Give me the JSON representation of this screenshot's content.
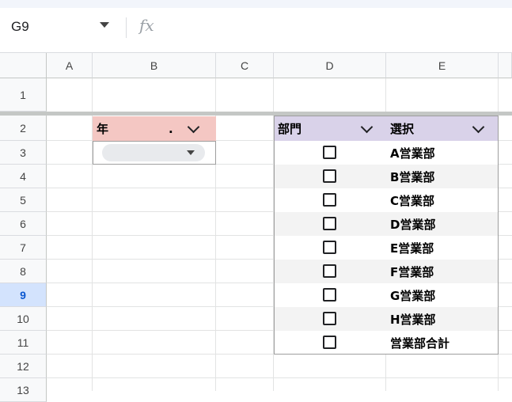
{
  "formula_bar": {
    "name_box": "G9",
    "fx_label": "fx",
    "formula": ""
  },
  "columns": [
    "A",
    "B",
    "C",
    "D",
    "E"
  ],
  "rows": [
    "1",
    "2",
    "3",
    "4",
    "5",
    "6",
    "7",
    "8",
    "9",
    "10",
    "11",
    "12",
    "13"
  ],
  "selected_row": "9",
  "year_header": {
    "label": "年",
    "dot": "."
  },
  "dept_table": {
    "header_dept": "部門",
    "header_select": "選択",
    "items": [
      "A営業部",
      "B営業部",
      "C営業部",
      "D営業部",
      "E営業部",
      "F営業部",
      "G営業部",
      "H営業部",
      "営業部合計"
    ]
  },
  "colors": {
    "year_header_bg": "#f4c7c3",
    "dept_header_bg": "#d9d2e9",
    "band_bg": "#f3f3f3",
    "selected_row_header": "#d3e3fd"
  }
}
